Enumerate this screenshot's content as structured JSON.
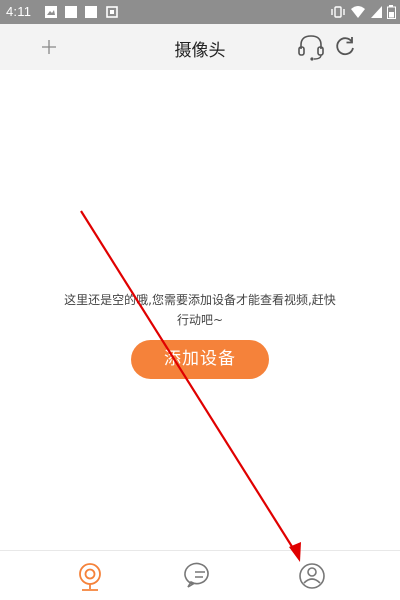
{
  "status_bar": {
    "time": "4:11"
  },
  "app_bar": {
    "title": "摄像头",
    "icons": [
      "plus-icon",
      "headset-icon",
      "refresh-icon"
    ]
  },
  "empty_state": {
    "message": "这里还是空的哦,您需要添加设备才能查看视频,赶快行动吧~",
    "button_label": "添加设备"
  },
  "bottom_nav": {
    "items": [
      "camera-icon",
      "message-icon",
      "profile-icon"
    ]
  },
  "colors": {
    "accent": "#f5823a",
    "status_bar": "#8e8e8e",
    "app_bar": "#f3f3f3",
    "annotation_arrow": "#e00000"
  }
}
